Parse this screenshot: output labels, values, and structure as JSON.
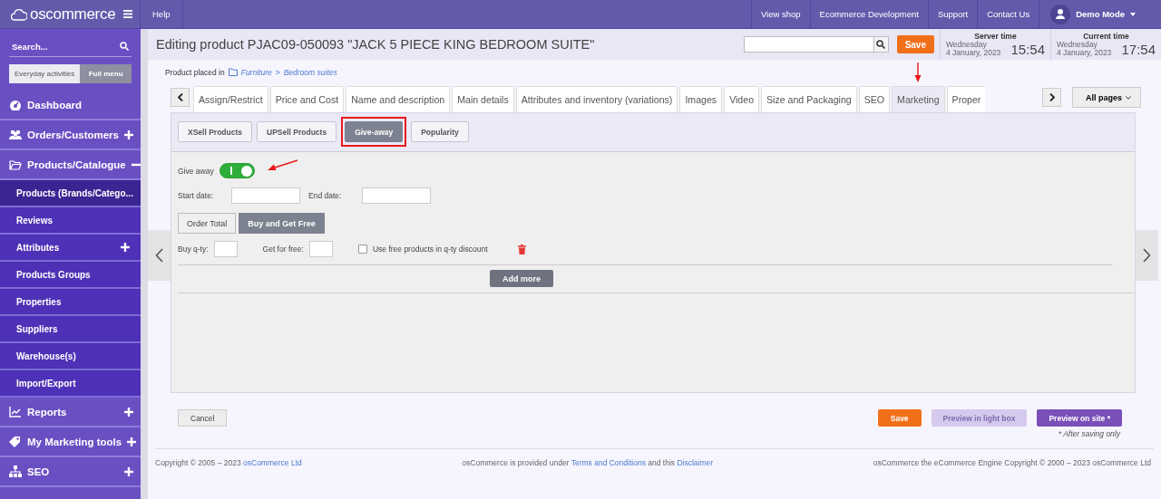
{
  "topbar": {
    "logo": "oscommerce",
    "help": "Help",
    "links": [
      "View shop",
      "Ecommerce Development",
      "Support",
      "Contact Us"
    ],
    "user": "Demo Mode"
  },
  "sidebar": {
    "search_placeholder": "Search...",
    "modes": [
      {
        "label": "Everyday activities",
        "selected": false
      },
      {
        "label": "Full menu",
        "selected": true
      }
    ],
    "items": [
      {
        "label": "Dashboard"
      },
      {
        "label": "Orders/Customers",
        "expanded": false
      },
      {
        "label": "Products/Catalogue",
        "expanded": true,
        "children": [
          {
            "label": "Products (Brands/Catego...",
            "selected": true
          },
          {
            "label": "Reviews",
            "selected": false
          },
          {
            "label": "Attributes",
            "selected": false,
            "expanded": false
          },
          {
            "label": "Products Groups",
            "selected": false
          },
          {
            "label": "Properties",
            "selected": false
          },
          {
            "label": "Suppliers",
            "selected": false
          },
          {
            "label": "Warehouse(s)",
            "selected": false
          },
          {
            "label": "Import/Export",
            "selected": false
          }
        ]
      },
      {
        "label": "Reports",
        "expanded": false
      },
      {
        "label": "My Marketing tools",
        "expanded": false
      },
      {
        "label": "SEO",
        "expanded": false
      }
    ]
  },
  "header": {
    "title": "Editing product PJAC09-050093 \"JACK 5 PIECE KING BEDROOM SUITE\"",
    "save": "Save",
    "clocks": [
      {
        "label": "Server time",
        "day": "Wednesday",
        "date": "4 January, 2023",
        "time": "15:54"
      },
      {
        "label": "Current time",
        "day": "Wednesday",
        "date": "4 January, 2023",
        "time": "17:54"
      }
    ]
  },
  "breadcrumb": {
    "prefix": "Product placed in",
    "path": [
      "Furniture",
      "Bedroom suites"
    ],
    "separator": ">"
  },
  "tabs": [
    {
      "label": "Assign/Restrict",
      "selected": false,
      "marked": false
    },
    {
      "label": "Price and Cost",
      "selected": false,
      "marked": false
    },
    {
      "label": "Name and description",
      "selected": false,
      "marked": false
    },
    {
      "label": "Main details",
      "selected": false,
      "marked": false
    },
    {
      "label": "Attributes and inventory (variations)",
      "selected": false,
      "marked": false
    },
    {
      "label": "Images",
      "selected": false,
      "marked": false
    },
    {
      "label": "Video",
      "selected": false,
      "marked": false
    },
    {
      "label": "Size and Packaging",
      "selected": false,
      "marked": false
    },
    {
      "label": "SEO",
      "selected": false,
      "marked": false
    },
    {
      "label": "Marketing",
      "selected": true,
      "marked": true
    },
    {
      "label": "Proper",
      "selected": false,
      "marked": false
    }
  ],
  "all_pages": "All pages",
  "subtabs": [
    {
      "label": "XSell Products",
      "selected": false,
      "highlighted": false
    },
    {
      "label": "UPSell Products",
      "selected": false,
      "highlighted": false
    },
    {
      "label": "Give-away",
      "selected": true,
      "highlighted": true
    },
    {
      "label": "Popularity",
      "selected": false,
      "highlighted": false
    }
  ],
  "giveaway": {
    "label": "Give away",
    "on": true,
    "start_label": "Start date:",
    "end_label": "End date:",
    "modes": [
      {
        "label": "Order Total",
        "selected": false
      },
      {
        "label": "Buy and Get Free",
        "selected": true
      }
    ],
    "rows": [
      {
        "buy_label": "Buy q-ty:",
        "free_label": "Get for free:",
        "use_label": "Use free products in q-ty discount",
        "checked": false
      }
    ],
    "add_more": "Add more"
  },
  "actions": {
    "cancel": "Cancel",
    "buttons": [
      {
        "label": "Save",
        "kind": "primary",
        "disabled": false
      },
      {
        "label": "Preview in light box",
        "kind": "accent",
        "disabled": true
      },
      {
        "label": "Preview on site *",
        "kind": "accent",
        "disabled": false
      }
    ],
    "note": "* After saving only"
  },
  "footer": [
    [
      {
        "kind": "text",
        "text": "Copyright © 2005 – 2023"
      },
      {
        "kind": "link",
        "text": "osCommerce Ltd"
      }
    ],
    [
      {
        "kind": "text",
        "text": "osCommerce is provided under"
      },
      {
        "kind": "link",
        "text": "Terms and Conditions"
      },
      {
        "kind": "text",
        "text": "and this"
      },
      {
        "kind": "link",
        "text": "Disclaimer"
      }
    ],
    [
      {
        "kind": "text",
        "text": "osCommerce the eCommerce Engine Copyright © 2000 – 2023 osCommerce Ltd"
      }
    ]
  ]
}
